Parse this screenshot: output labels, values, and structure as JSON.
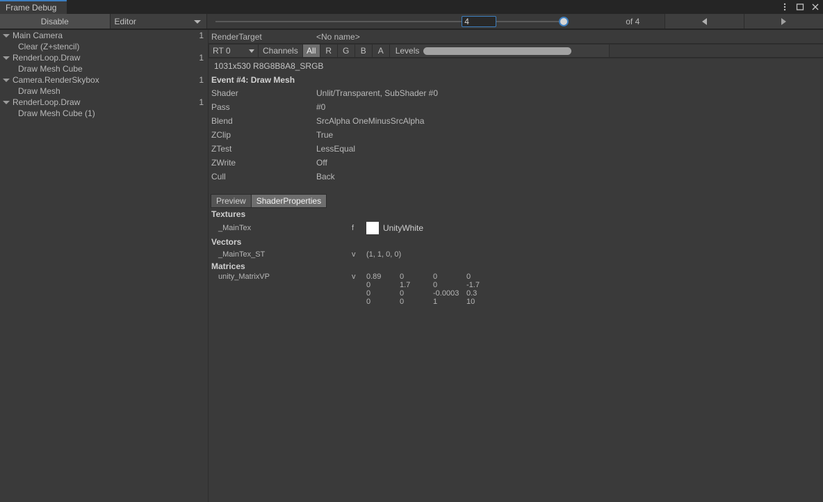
{
  "window": {
    "tab_label": "Frame Debug",
    "accent_color": "#3c7ebf",
    "controls": {
      "menu": "kebab-menu-icon",
      "maximize": "maximize-icon",
      "close": "close-icon"
    }
  },
  "toolbar": {
    "disable_label": "Disable",
    "target_dropdown": "Editor",
    "frame_value": "4",
    "frame_total_label": "of 4",
    "prev_label": "prev-frame",
    "next_label": "next-frame"
  },
  "tree": {
    "items": [
      {
        "label": "Main Camera",
        "foldout": true,
        "indent": 0,
        "count": "1"
      },
      {
        "label": "Clear (Z+stencil)",
        "foldout": false,
        "indent": 1,
        "count": ""
      },
      {
        "label": "RenderLoop.Draw",
        "foldout": true,
        "indent": 0,
        "count": "1"
      },
      {
        "label": "Draw Mesh Cube",
        "foldout": false,
        "indent": 1,
        "count": ""
      },
      {
        "label": "Camera.RenderSkybox",
        "foldout": true,
        "indent": 0,
        "count": "1"
      },
      {
        "label": "Draw Mesh",
        "foldout": false,
        "indent": 1,
        "count": ""
      },
      {
        "label": "RenderLoop.Draw",
        "foldout": true,
        "indent": 0,
        "count": "1"
      },
      {
        "label": "Draw Mesh Cube (1)",
        "foldout": false,
        "indent": 1,
        "count": ""
      }
    ]
  },
  "rendertarget": {
    "label": "RenderTarget",
    "name": "<No name>",
    "rt_select": "RT 0",
    "channels_label": "Channels",
    "channels": [
      {
        "label": "All",
        "active": true
      },
      {
        "label": "R",
        "active": false
      },
      {
        "label": "G",
        "active": false
      },
      {
        "label": "B",
        "active": false
      },
      {
        "label": "A",
        "active": false
      }
    ],
    "levels_label": "Levels",
    "info": "1031x530 R8G8B8A8_SRGB"
  },
  "event": {
    "title": "Event #4: Draw Mesh",
    "properties": [
      {
        "key": "Shader",
        "value": "Unlit/Transparent, SubShader #0"
      },
      {
        "key": "Pass",
        "value": "#0"
      },
      {
        "key": "Blend",
        "value": "SrcAlpha OneMinusSrcAlpha"
      },
      {
        "key": "ZClip",
        "value": "True"
      },
      {
        "key": "ZTest",
        "value": "LessEqual"
      },
      {
        "key": "ZWrite",
        "value": "Off"
      },
      {
        "key": "Cull",
        "value": "Back"
      }
    ]
  },
  "mode_tabs": [
    {
      "label": "Preview",
      "active": false
    },
    {
      "label": "ShaderProperties",
      "active": true
    }
  ],
  "shader_properties": {
    "textures_header": "Textures",
    "textures": [
      {
        "name": "_MainTex",
        "type": "f",
        "swatch_color": "#ffffff",
        "value": "UnityWhite"
      }
    ],
    "vectors_header": "Vectors",
    "vectors": [
      {
        "name": "_MainTex_ST",
        "type": "v",
        "value": "(1, 1, 0, 0)"
      }
    ],
    "matrices_header": "Matrices",
    "matrices": [
      {
        "name": "unity_MatrixVP",
        "type": "v",
        "rows": [
          [
            "0.89",
            "0",
            "0",
            "0"
          ],
          [
            "0",
            "1.7",
            "0",
            "-1.7"
          ],
          [
            "0",
            "0",
            "-0.0003",
            "0.3"
          ],
          [
            "0",
            "0",
            "1",
            "10"
          ]
        ]
      }
    ]
  }
}
